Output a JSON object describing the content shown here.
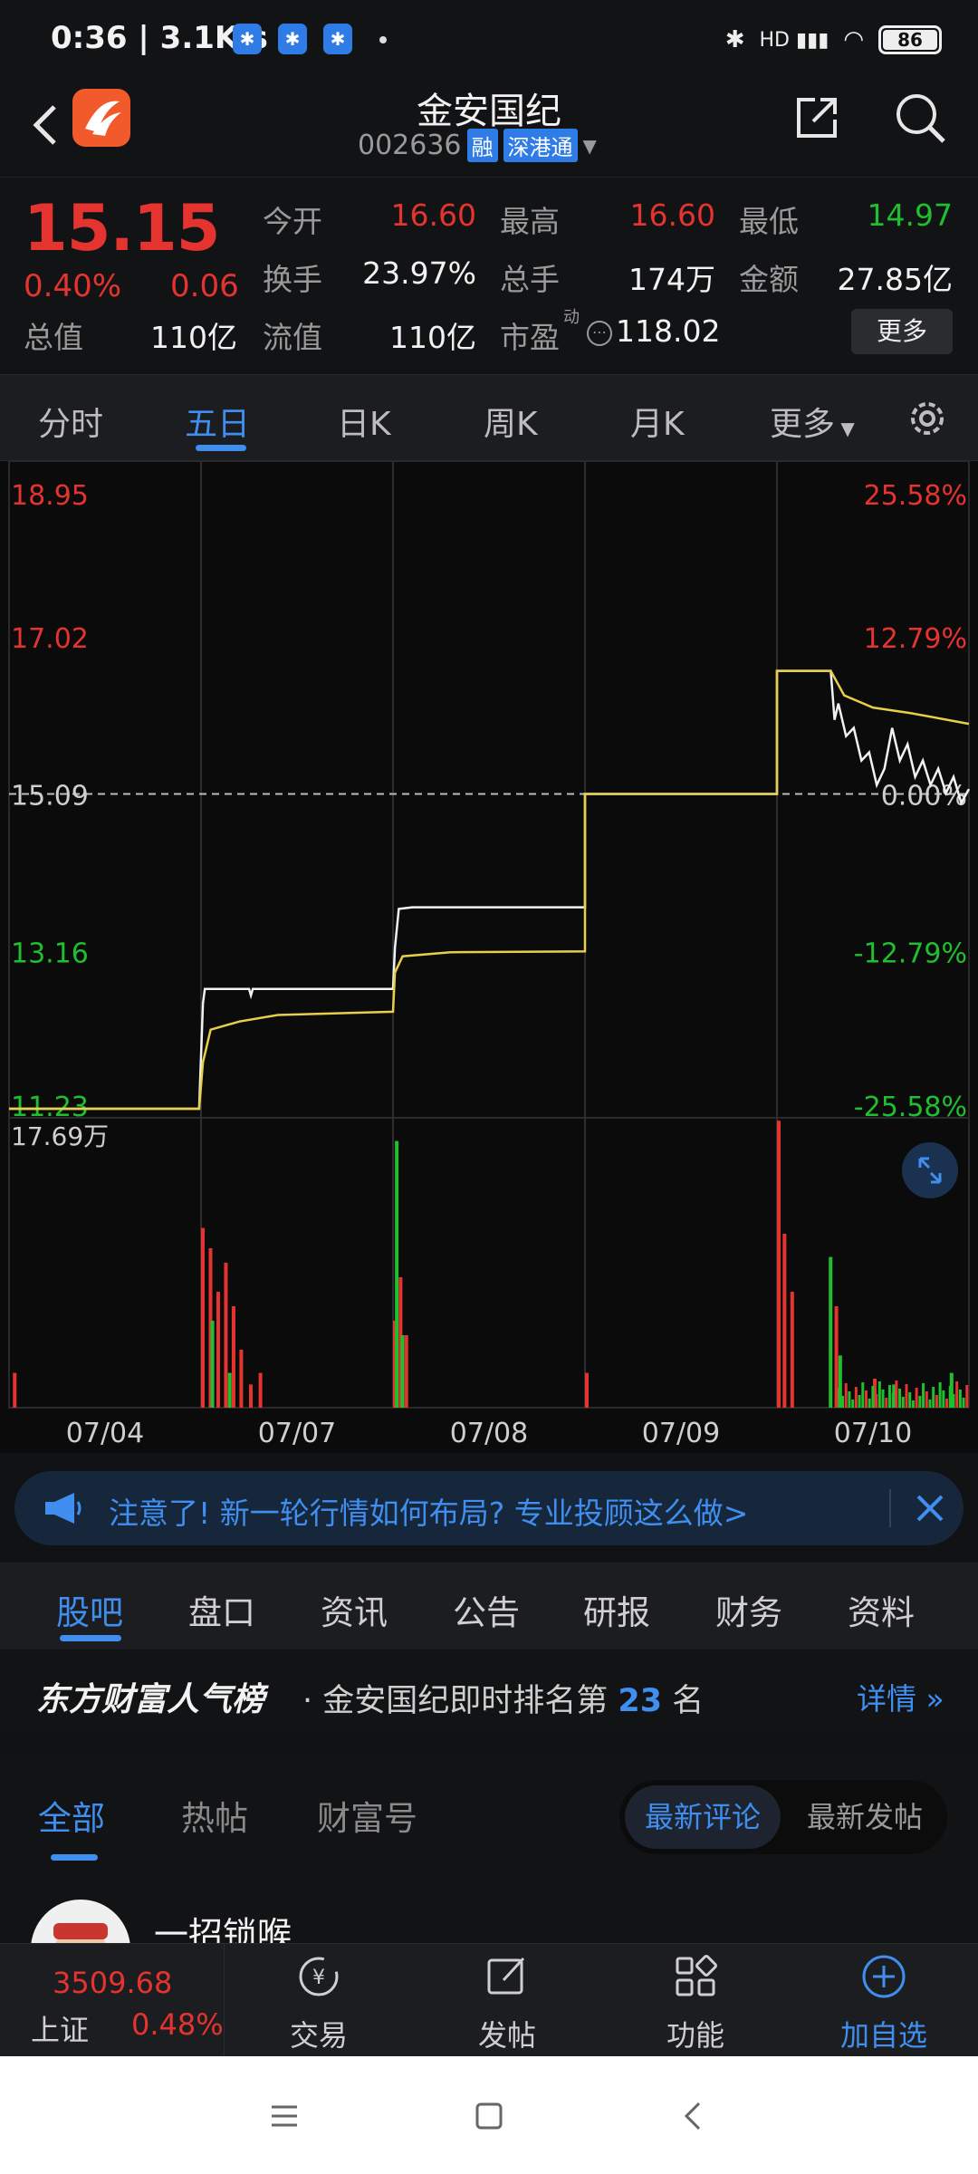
{
  "status": {
    "time": "0:36 | 3.1K/s",
    "battery": "86",
    "network": "HD"
  },
  "header": {
    "title": "金安国纪",
    "code": "002636",
    "tag1": "融",
    "tag2": "深港通"
  },
  "quote": {
    "price": "15.15",
    "pct": "0.40%",
    "change": "0.06",
    "rows": [
      {
        "l1": "今开",
        "v1": "16.60",
        "l2": "最高",
        "v2": "16.60",
        "l3": "最低",
        "v3": "14.97"
      },
      {
        "l1": "换手",
        "v1": "23.97%",
        "l2": "总手",
        "v2": "174万",
        "l3": "金额",
        "v3": "27.85亿"
      },
      {
        "l0": "总值",
        "v0": "110亿",
        "l1": "流值",
        "v1": "110亿",
        "l2": "市盈",
        "sup": "动",
        "v2": "118.02"
      }
    ],
    "more": "更多"
  },
  "chart_tabs": [
    "分时",
    "五日",
    "日K",
    "周K",
    "月K",
    "更多"
  ],
  "chart_data": {
    "type": "line",
    "title": "",
    "price_axis": [
      "18.95",
      "17.02",
      "15.09",
      "13.16",
      "11.23"
    ],
    "pct_axis": [
      "25.58%",
      "12.79%",
      "0.00%",
      "-12.79%",
      "-25.58%"
    ],
    "prev_close": 15.09,
    "ylim": [
      11.23,
      18.95
    ],
    "x_dates": [
      "07/04",
      "07/07",
      "07/08",
      "07/09",
      "07/10"
    ],
    "series": [
      {
        "color": "#f2f2f2",
        "points": [
          [
            0,
            11.23
          ],
          [
            0.99,
            11.23
          ],
          [
            1.01,
            12.52
          ],
          [
            1.02,
            12.7
          ],
          [
            1.25,
            12.7
          ],
          [
            1.26,
            12.62
          ],
          [
            1.27,
            12.7
          ],
          [
            2.0,
            12.7
          ],
          [
            2.01,
            13.2
          ],
          [
            2.03,
            13.68
          ],
          [
            2.1,
            13.7
          ],
          [
            3.0,
            13.7
          ],
          [
            3.0,
            15.09
          ],
          [
            4.0,
            15.09
          ],
          [
            4.0,
            16.6
          ],
          [
            4.28,
            16.6
          ],
          [
            4.3,
            16.0
          ],
          [
            4.32,
            16.2
          ],
          [
            4.36,
            15.8
          ],
          [
            4.4,
            15.9
          ],
          [
            4.44,
            15.5
          ],
          [
            4.48,
            15.6
          ],
          [
            4.52,
            15.2
          ],
          [
            4.56,
            15.4
          ],
          [
            4.6,
            15.9
          ],
          [
            4.64,
            15.5
          ],
          [
            4.68,
            15.7
          ],
          [
            4.72,
            15.3
          ],
          [
            4.76,
            15.5
          ],
          [
            4.8,
            15.2
          ],
          [
            4.84,
            15.4
          ],
          [
            4.88,
            15.1
          ],
          [
            4.92,
            15.3
          ],
          [
            4.96,
            14.98
          ],
          [
            5.0,
            15.15
          ]
        ]
      },
      {
        "color": "#e7cf4a",
        "points": [
          [
            0,
            11.23
          ],
          [
            0.99,
            11.23
          ],
          [
            1.01,
            11.8
          ],
          [
            1.05,
            12.2
          ],
          [
            1.2,
            12.3
          ],
          [
            1.4,
            12.38
          ],
          [
            2.0,
            12.42
          ],
          [
            2.01,
            12.9
          ],
          [
            2.05,
            13.1
          ],
          [
            2.3,
            13.15
          ],
          [
            3.0,
            13.16
          ],
          [
            3.0,
            15.09
          ],
          [
            4.0,
            15.09
          ],
          [
            4.0,
            16.6
          ],
          [
            4.28,
            16.6
          ],
          [
            4.35,
            16.3
          ],
          [
            4.5,
            16.15
          ],
          [
            4.7,
            16.08
          ],
          [
            5.0,
            15.95
          ]
        ]
      }
    ],
    "volume_max_label": "17.69万",
    "volume": {
      "red": [
        [
          0.02,
          0.12
        ],
        [
          1.0,
          0.62
        ],
        [
          1.04,
          0.55
        ],
        [
          1.08,
          0.4
        ],
        [
          1.12,
          0.5
        ],
        [
          1.16,
          0.35
        ],
        [
          1.2,
          0.2
        ],
        [
          1.25,
          0.08
        ],
        [
          1.3,
          0.12
        ],
        [
          2.0,
          0.3
        ],
        [
          2.03,
          0.45
        ],
        [
          2.06,
          0.25
        ],
        [
          3.0,
          0.12
        ],
        [
          4.0,
          0.99
        ],
        [
          4.03,
          0.6
        ],
        [
          4.07,
          0.4
        ],
        [
          4.3,
          0.35
        ],
        [
          4.5,
          0.1
        ]
      ],
      "green": [
        [
          1.05,
          0.3
        ],
        [
          1.14,
          0.12
        ],
        [
          2.01,
          0.92
        ],
        [
          2.04,
          0.25
        ],
        [
          4.27,
          0.52
        ],
        [
          4.32,
          0.18
        ],
        [
          4.6,
          0.08
        ],
        [
          4.9,
          0.12
        ]
      ]
    }
  },
  "banner": {
    "text": "注意了! 新一轮行情如何布局? 专业投顾这么做>"
  },
  "section_tabs": [
    "股吧",
    "盘口",
    "资讯",
    "公告",
    "研报",
    "财务",
    "资料"
  ],
  "ranking": {
    "brand": "东方财富人气榜",
    "text": "· 金安国纪即时排名第",
    "rank": "23",
    "suffix": "名",
    "detail": "详情"
  },
  "feed_tabs": [
    "全部",
    "热帖",
    "财富号"
  ],
  "feed_sort": {
    "on": "最新评论",
    "off": "最新发帖"
  },
  "post": {
    "user": "一招锁喉"
  },
  "bottom": {
    "index_value": "3509.68",
    "index_name": "上证",
    "index_pct": "0.48%",
    "items": [
      "交易",
      "发帖",
      "功能",
      "加自选"
    ]
  }
}
